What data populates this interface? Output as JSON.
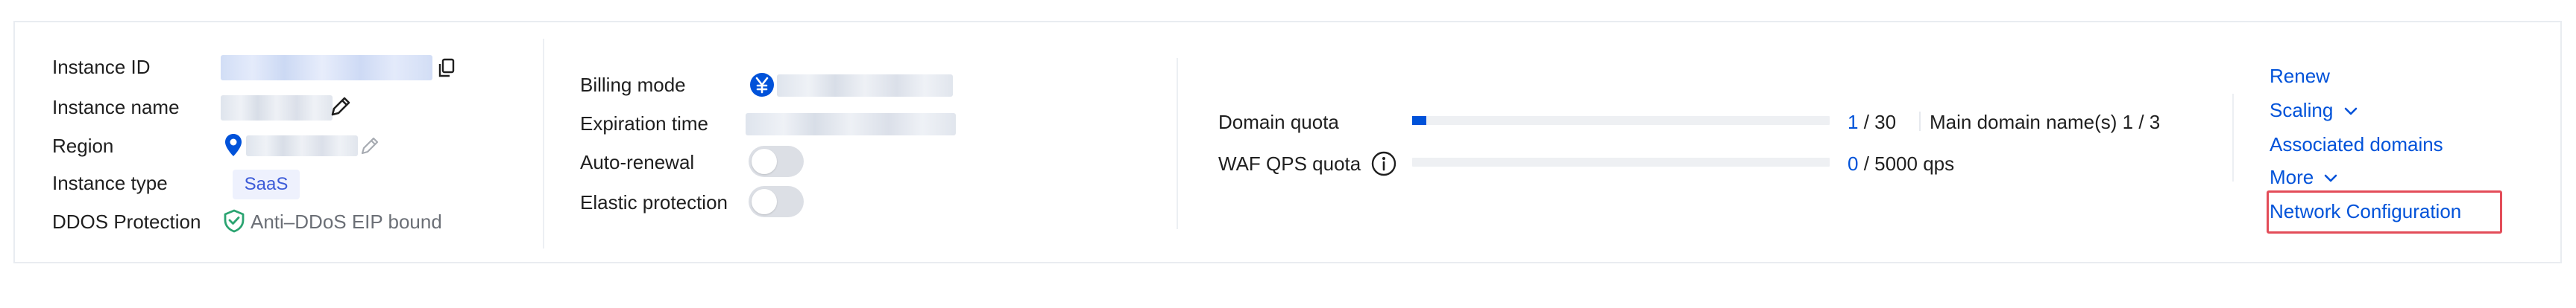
{
  "instance": {
    "id_label": "Instance ID",
    "name_label": "Instance name",
    "region_label": "Region",
    "type_label": "Instance type",
    "type_value": "SaaS",
    "ddos_label": "DDOS Protection",
    "ddos_value": "Anti–DDoS EIP bound",
    "copy_icon": "copy-icon",
    "edit_icon": "pencil-icon",
    "location_icon": "location-pin-icon",
    "shield_icon": "shield-check-icon"
  },
  "billing": {
    "mode_label": "Billing mode",
    "expiration_label": "Expiration time",
    "auto_renewal_label": "Auto-renewal",
    "elastic_label": "Elastic protection",
    "mode_icon": "yen-circle-icon",
    "auto_renewal_on": false,
    "elastic_on": false
  },
  "quota": {
    "domain_label": "Domain quota",
    "domain_used": "1",
    "domain_total": " / 30",
    "domain_fraction": 0.0333,
    "main_domain_text": "Main domain name(s) 1 / 3",
    "qps_label": "WAF QPS quota",
    "qps_used": "0",
    "qps_total": " / 5000 qps",
    "qps_fraction": 0,
    "info_icon": "info-circle-icon"
  },
  "actions": {
    "renew": "Renew",
    "scaling": "Scaling",
    "associated_domains": "Associated domains",
    "more": "More",
    "network_configuration": "Network Configuration",
    "chevron_icon": "chevron-down-icon"
  },
  "colors": {
    "accent": "#0052d9",
    "badge_bg": "#eef1fd",
    "shield_green": "#2ba471",
    "highlight_red": "#e34d59",
    "track": "#eef0f3"
  }
}
